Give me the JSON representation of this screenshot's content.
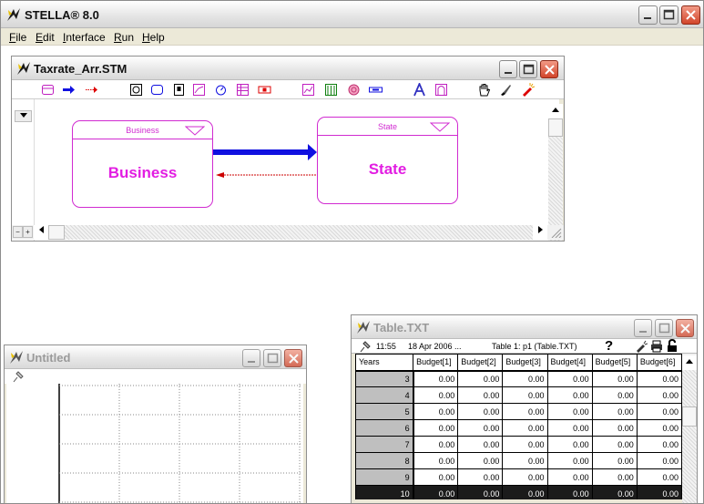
{
  "app": {
    "title": "STELLA® 8.0",
    "menu": [
      "File",
      "Edit",
      "Interface",
      "Run",
      "Help"
    ],
    "menu_mnemonic_index": [
      0,
      0,
      0,
      0,
      0
    ]
  },
  "model_window": {
    "title": "Taxrate_Arr.STM",
    "tools": [
      "stock-icon",
      "flow-icon",
      "connector-icon",
      "decision-process-icon",
      "module-icon",
      "button-icon",
      "sector-icon",
      "graph-pad-icon",
      "table-pad-icon",
      "numeric-display-icon",
      "slider-icon",
      "knob-icon",
      "list-input-icon",
      "text-icon",
      "picture-icon",
      "hand-icon",
      "paintbrush-icon",
      "dynamite-icon"
    ],
    "modules": [
      {
        "header": "Business",
        "name": "Business"
      },
      {
        "header": "State",
        "name": "State"
      }
    ],
    "zoom_out": "−",
    "zoom_in": "+"
  },
  "graph_window": {
    "title": "Untitled"
  },
  "table_window": {
    "title": "Table.TXT",
    "time": "11:55",
    "date": "18 Apr 2006 ...",
    "caption": "Table 1: p1 (Table.TXT)",
    "help": "?",
    "columns": [
      "Years",
      "Budget[1]",
      "Budget[2]",
      "Budget[3]",
      "Budget[4]",
      "Budget[5]",
      "Budget[6]"
    ],
    "rows": [
      {
        "year": "3",
        "values": [
          "0.00",
          "0.00",
          "0.00",
          "0.00",
          "0.00",
          "0.00"
        ]
      },
      {
        "year": "4",
        "values": [
          "0.00",
          "0.00",
          "0.00",
          "0.00",
          "0.00",
          "0.00"
        ]
      },
      {
        "year": "5",
        "values": [
          "0.00",
          "0.00",
          "0.00",
          "0.00",
          "0.00",
          "0.00"
        ]
      },
      {
        "year": "6",
        "values": [
          "0.00",
          "0.00",
          "0.00",
          "0.00",
          "0.00",
          "0.00"
        ]
      },
      {
        "year": "7",
        "values": [
          "0.00",
          "0.00",
          "0.00",
          "0.00",
          "0.00",
          "0.00"
        ]
      },
      {
        "year": "8",
        "values": [
          "0.00",
          "0.00",
          "0.00",
          "0.00",
          "0.00",
          "0.00"
        ]
      },
      {
        "year": "9",
        "values": [
          "0.00",
          "0.00",
          "0.00",
          "0.00",
          "0.00",
          "0.00"
        ]
      },
      {
        "year": "10",
        "values": [
          "0.00",
          "0.00",
          "0.00",
          "0.00",
          "0.00",
          "0.00"
        ]
      }
    ],
    "selected_row_index": 7
  },
  "colors": {
    "module_magenta": "#e21de2",
    "flow_blue": "#1010e0",
    "connector_red": "#cc0000"
  }
}
